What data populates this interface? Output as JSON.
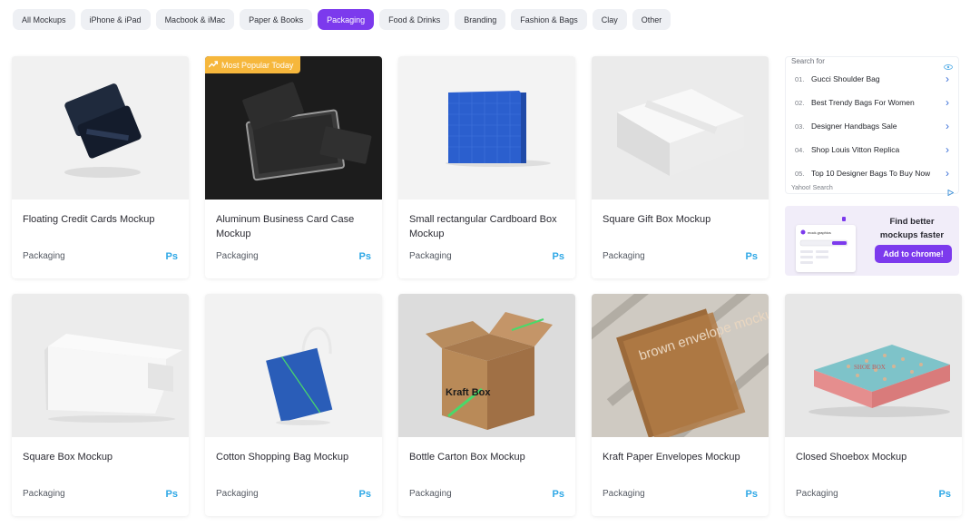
{
  "filters": {
    "items": [
      {
        "label": "All Mockups"
      },
      {
        "label": "iPhone & iPad"
      },
      {
        "label": "Macbook & iMac"
      },
      {
        "label": "Paper & Books"
      },
      {
        "label": "Packaging"
      },
      {
        "label": "Food & Drinks"
      },
      {
        "label": "Branding"
      },
      {
        "label": "Fashion & Bags"
      },
      {
        "label": "Clay"
      },
      {
        "label": "Other"
      }
    ],
    "active": "Packaging",
    "active_color": "#7c3aed"
  },
  "cards": [
    {
      "title": "Floating Credit Cards Mockup",
      "category": "Packaging",
      "app": "Ps",
      "thumb": "floating-credit-cards"
    },
    {
      "title": "Aluminum Business Card Case Mockup",
      "category": "Packaging",
      "app": "Ps",
      "thumb": "aluminum-card-case",
      "badge": "Most Popular Today"
    },
    {
      "title": "Small rectangular Cardboard Box Mockup",
      "category": "Packaging",
      "app": "Ps",
      "thumb": "blue-cardboard-box"
    },
    {
      "title": "Square Gift Box Mockup",
      "category": "Packaging",
      "app": "Ps",
      "thumb": "white-gift-box"
    },
    {
      "title": "Square Box Mockup",
      "category": "Packaging",
      "app": "Ps",
      "thumb": "open-white-box"
    },
    {
      "title": "Cotton Shopping Bag Mockup",
      "category": "Packaging",
      "app": "Ps",
      "thumb": "tote-bag"
    },
    {
      "title": "Bottle Carton Box Mockup",
      "category": "Packaging",
      "app": "Ps",
      "thumb": "kraft-carton-box",
      "thumb_text": "Kraft Box"
    },
    {
      "title": "Kraft Paper Envelopes Mockup",
      "category": "Packaging",
      "app": "Ps",
      "thumb": "kraft-envelopes",
      "thumb_text": "brown envelope mockup"
    },
    {
      "title": "Closed Shoebox Mockup",
      "category": "Packaging",
      "app": "Ps",
      "thumb": "shoebox",
      "thumb_text": "SHOE BOX"
    }
  ],
  "ad": {
    "header": "Search for",
    "items": [
      {
        "num": "01.",
        "text": "Gucci Shoulder Bag"
      },
      {
        "num": "02.",
        "text": "Best Trendy Bags For Women"
      },
      {
        "num": "03.",
        "text": "Designer Handbags Sale"
      },
      {
        "num": "04.",
        "text": "Shop Louis Vitton Replica"
      },
      {
        "num": "05.",
        "text": "Top 10 Designer Bags To Buy Now"
      }
    ],
    "footer": "Yahoo! Search"
  },
  "promo": {
    "title": "Find better mockups faster",
    "button": "Add to chrome!",
    "preview_brand": "mock.graphics"
  },
  "colors": {
    "ps_blue": "#2fa8e6",
    "badge": "#f6b73c",
    "link_blue": "#3a6fd8"
  }
}
